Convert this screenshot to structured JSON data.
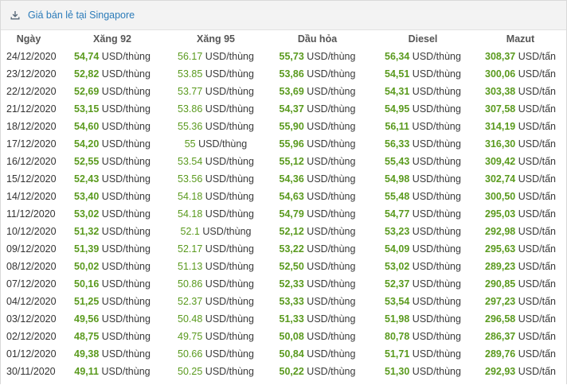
{
  "header": {
    "title": "Giá bán lẻ tại Singapore",
    "icon": "download-icon"
  },
  "table": {
    "columns": [
      "Ngày",
      "Xăng 92",
      "Xăng 95",
      "Dầu hỏa",
      "Diesel",
      "Mazut"
    ],
    "rows": [
      {
        "date": "24/12/2020",
        "x92": "54,74",
        "x95": "56.17",
        "dau_hoa": "55,73",
        "diesel": "56,34",
        "mazut": "308,37"
      },
      {
        "date": "23/12/2020",
        "x92": "52,82",
        "x95": "53.85",
        "dau_hoa": "53,86",
        "diesel": "54,51",
        "mazut": "300,06"
      },
      {
        "date": "22/12/2020",
        "x92": "52,69",
        "x95": "53.77",
        "dau_hoa": "53,69",
        "diesel": "54,31",
        "mazut": "303,38"
      },
      {
        "date": "21/12/2020",
        "x92": "53,15",
        "x95": "53.86",
        "dau_hoa": "54,37",
        "diesel": "54,95",
        "mazut": "307,58"
      },
      {
        "date": "18/12/2020",
        "x92": "54,60",
        "x95": "55.36",
        "dau_hoa": "55,90",
        "diesel": "56,11",
        "mazut": "314,19"
      },
      {
        "date": "17/12/2020",
        "x92": "54,20",
        "x95": "55",
        "dau_hoa": "55,96",
        "diesel": "56,33",
        "mazut": "316,30"
      },
      {
        "date": "16/12/2020",
        "x92": "52,55",
        "x95": "53.54",
        "dau_hoa": "55,12",
        "diesel": "55,43",
        "mazut": "309,42"
      },
      {
        "date": "15/12/2020",
        "x92": "52,43",
        "x95": "53.56",
        "dau_hoa": "54,36",
        "diesel": "54,98",
        "mazut": "302,74"
      },
      {
        "date": "14/12/2020",
        "x92": "53,40",
        "x95": "54.18",
        "dau_hoa": "54,63",
        "diesel": "55,48",
        "mazut": "300,50"
      },
      {
        "date": "11/12/2020",
        "x92": "53,02",
        "x95": "54.18",
        "dau_hoa": "54,79",
        "diesel": "54,77",
        "mazut": "295,03"
      },
      {
        "date": "10/12/2020",
        "x92": "51,32",
        "x95": "52.1",
        "dau_hoa": "52,12",
        "diesel": "53,23",
        "mazut": "292,98"
      },
      {
        "date": "09/12/2020",
        "x92": "51,39",
        "x95": "52.17",
        "dau_hoa": "53,22",
        "diesel": "54,09",
        "mazut": "295,63"
      },
      {
        "date": "08/12/2020",
        "x92": "50,02",
        "x95": "51.13",
        "dau_hoa": "52,50",
        "diesel": "53,02",
        "mazut": "289,23"
      },
      {
        "date": "07/12/2020",
        "x92": "50,16",
        "x95": "50.86",
        "dau_hoa": "52,33",
        "diesel": "52,37",
        "mazut": "290,85"
      },
      {
        "date": "04/12/2020",
        "x92": "51,25",
        "x95": "52.37",
        "dau_hoa": "53,33",
        "diesel": "53,54",
        "mazut": "297,23"
      },
      {
        "date": "03/12/2020",
        "x92": "49,56",
        "x95": "50.48",
        "dau_hoa": "51,33",
        "diesel": "51,98",
        "mazut": "296,58"
      },
      {
        "date": "02/12/2020",
        "x92": "48,75",
        "x95": "49.75",
        "dau_hoa": "50,08",
        "diesel": "80,78",
        "mazut": "286,37"
      },
      {
        "date": "01/12/2020",
        "x92": "49,38",
        "x95": "50.66",
        "dau_hoa": "50,84",
        "diesel": "51,71",
        "mazut": "289,76"
      },
      {
        "date": "30/11/2020",
        "x92": "49,11",
        "x95": "50.25",
        "dau_hoa": "50,22",
        "diesel": "51,30",
        "mazut": "292,93"
      }
    ],
    "unit_barrel": "USD/thùng",
    "unit_ton": "USD/tấn"
  },
  "colors": {
    "value_green": "#5a9a1e",
    "link_blue": "#2b7bb9",
    "header_bg": "#f3f3f3"
  }
}
